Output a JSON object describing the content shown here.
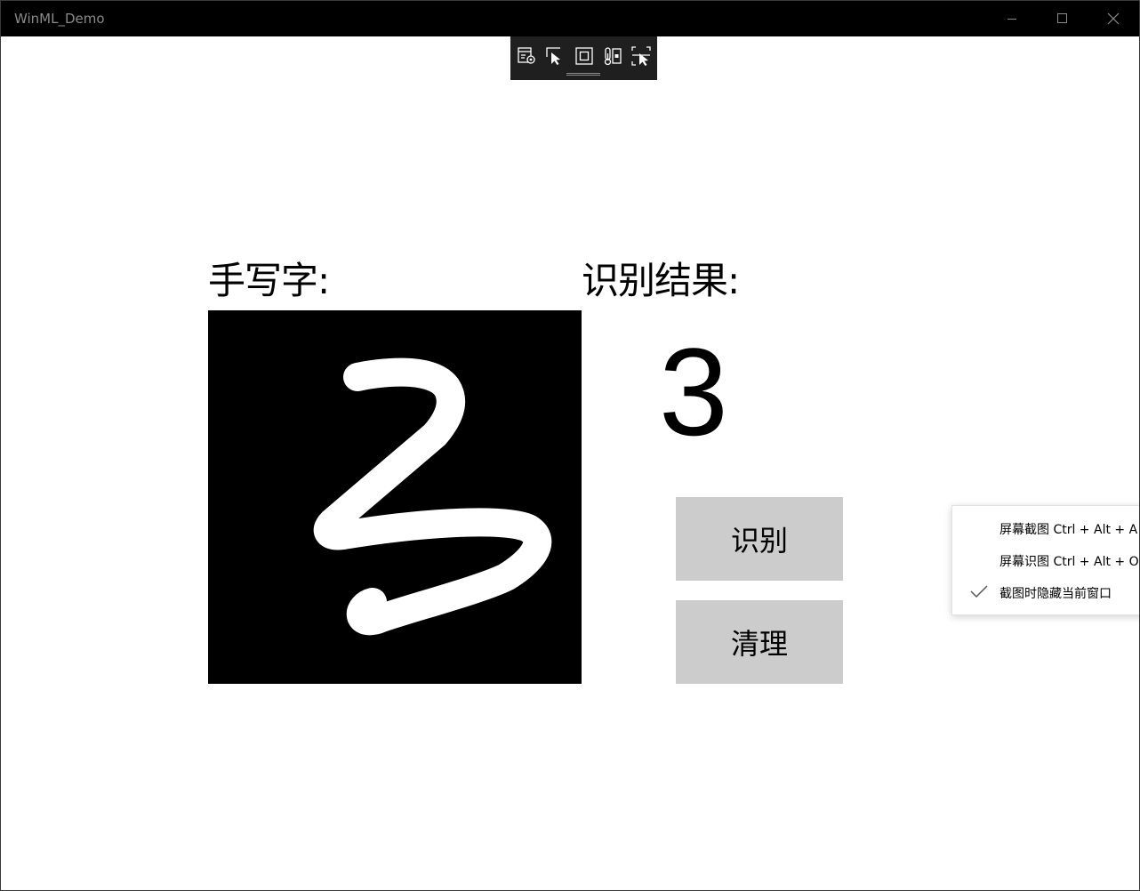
{
  "window": {
    "title": "WinML_Demo",
    "controls": {
      "minimize_icon": "minimize-icon",
      "maximize_icon": "maximize-icon",
      "close_icon": "close-icon"
    }
  },
  "debug_toolbar": {
    "icons": [
      "live-visual-tree-icon",
      "select-element-icon",
      "display-layout-adorners-icon",
      "track-focus-icon",
      "preview-selection-icon"
    ]
  },
  "main": {
    "handwriting_label": "手写字:",
    "result_label": "识别结果:",
    "result_value": "3",
    "recognize_button": "识别",
    "clear_button": "清理"
  },
  "context_menu": {
    "items": [
      {
        "label": "屏幕截图 Ctrl + Alt + A",
        "checked": false
      },
      {
        "label": "屏幕识图 Ctrl + Alt + O",
        "checked": false
      },
      {
        "label": "截图时隐藏当前窗口",
        "checked": true
      }
    ]
  },
  "colors": {
    "titlebar": "#000000",
    "canvas": "#000000",
    "ink": "#ffffff",
    "button": "#cccccc",
    "toolbar": "#1f1f1f"
  }
}
